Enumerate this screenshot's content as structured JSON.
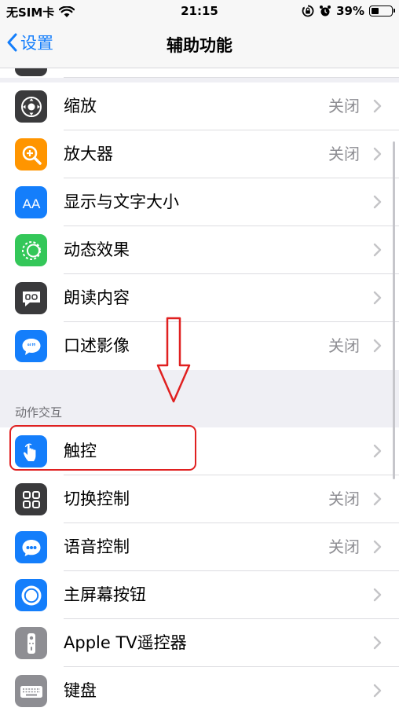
{
  "status": {
    "carrier": "无SIM卡",
    "time": "21:15",
    "battery": "39%",
    "battery_level": 0.39
  },
  "nav": {
    "back_label": "设置",
    "title": "辅助功能"
  },
  "colors": {
    "accent": "#147efb",
    "annotation": "#e02020"
  },
  "rows_top": [
    {
      "name": "zoom",
      "label": "缩放",
      "value": "关闭",
      "icon": "zoom-icon",
      "color": "#3a3a3c"
    },
    {
      "name": "magnifier",
      "label": "放大器",
      "value": "关闭",
      "icon": "magnifier-icon",
      "color": "#ff9500"
    },
    {
      "name": "display-text-size",
      "label": "显示与文字大小",
      "value": "",
      "icon": "text-size-icon",
      "color": "#147efb"
    },
    {
      "name": "motion",
      "label": "动态效果",
      "value": "",
      "icon": "motion-icon",
      "color": "#34c759"
    },
    {
      "name": "spoken-content",
      "label": "朗读内容",
      "value": "",
      "icon": "speech-icon",
      "color": "#3a3a3c"
    },
    {
      "name": "audio-descriptions",
      "label": "口述影像",
      "value": "关闭",
      "icon": "audio-description-icon",
      "color": "#147efb"
    }
  ],
  "section_header": "动作交互",
  "rows_bottom": [
    {
      "name": "touch",
      "label": "触控",
      "value": "",
      "icon": "touch-hand-icon",
      "color": "#147efb"
    },
    {
      "name": "switch-control",
      "label": "切换控制",
      "value": "关闭",
      "icon": "switch-control-icon",
      "color": "#3a3a3c"
    },
    {
      "name": "voice-control",
      "label": "语音控制",
      "value": "关闭",
      "icon": "voice-control-icon",
      "color": "#147efb"
    },
    {
      "name": "home-button",
      "label": "主屏幕按钮",
      "value": "",
      "icon": "home-button-icon",
      "color": "#147efb"
    },
    {
      "name": "apple-tv-remote",
      "label": "Apple TV遥控器",
      "value": "",
      "icon": "remote-icon",
      "color": "#8e8e93"
    },
    {
      "name": "keyboards",
      "label": "键盘",
      "value": "",
      "icon": "keyboard-icon",
      "color": "#8e8e93"
    }
  ]
}
